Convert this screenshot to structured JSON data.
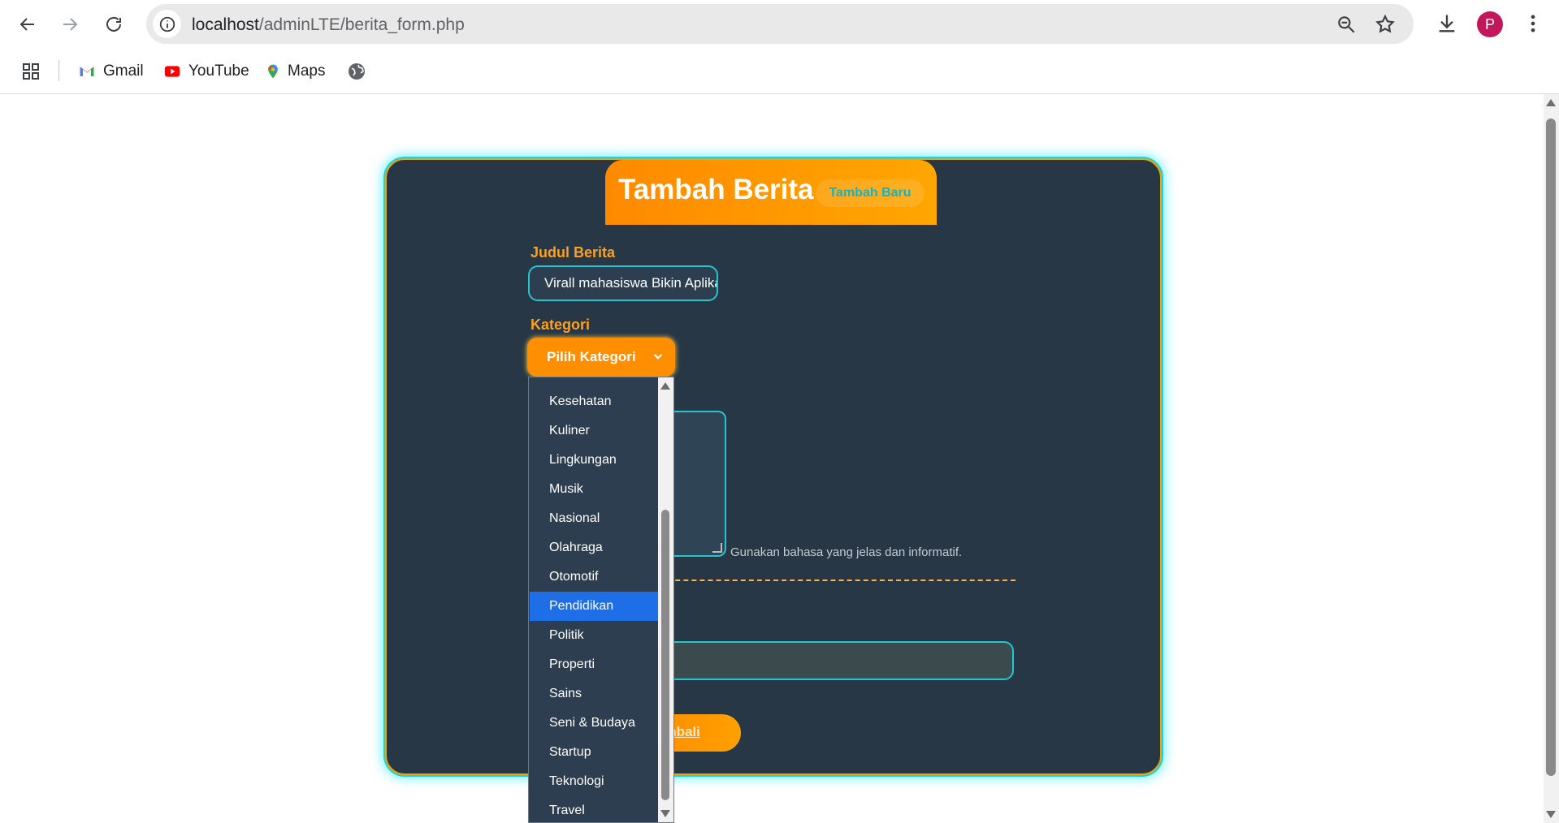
{
  "browser": {
    "url_host": "localhost",
    "url_path": "/adminLTE/berita_form.php",
    "avatar_letter": "P",
    "bookmarks": [
      {
        "label": "Gmail",
        "icon": "gmail-icon"
      },
      {
        "label": "YouTube",
        "icon": "youtube-icon"
      },
      {
        "label": "Maps",
        "icon": "maps-icon"
      }
    ]
  },
  "form": {
    "title": "Tambah Berita",
    "badge": "Tambah Baru",
    "judul_label": "Judul Berita",
    "judul_value": "Virall mahasiswa Bikin Aplikasi",
    "kategori_label": "Kategori",
    "kategori_selected": "Pilih Kategori",
    "content_hint": "Gunakan bahasa yang jelas dan informatif.",
    "image_hint": ".",
    "back_label": "embali"
  },
  "dropdown": {
    "options": [
      "Kesehatan",
      "Kuliner",
      "Lingkungan",
      "Musik",
      "Nasional",
      "Olahraga",
      "Otomotif",
      "Pendidikan",
      "Politik",
      "Properti",
      "Sains",
      "Seni & Budaya",
      "Startup",
      "Teknologi",
      "Travel"
    ],
    "highlighted": "Pendidikan"
  },
  "colors": {
    "card_bg": "#273746",
    "accent_orange": "#ff8f00",
    "accent_cyan": "#21c6d1",
    "highlight_blue": "#1e6ee8"
  }
}
